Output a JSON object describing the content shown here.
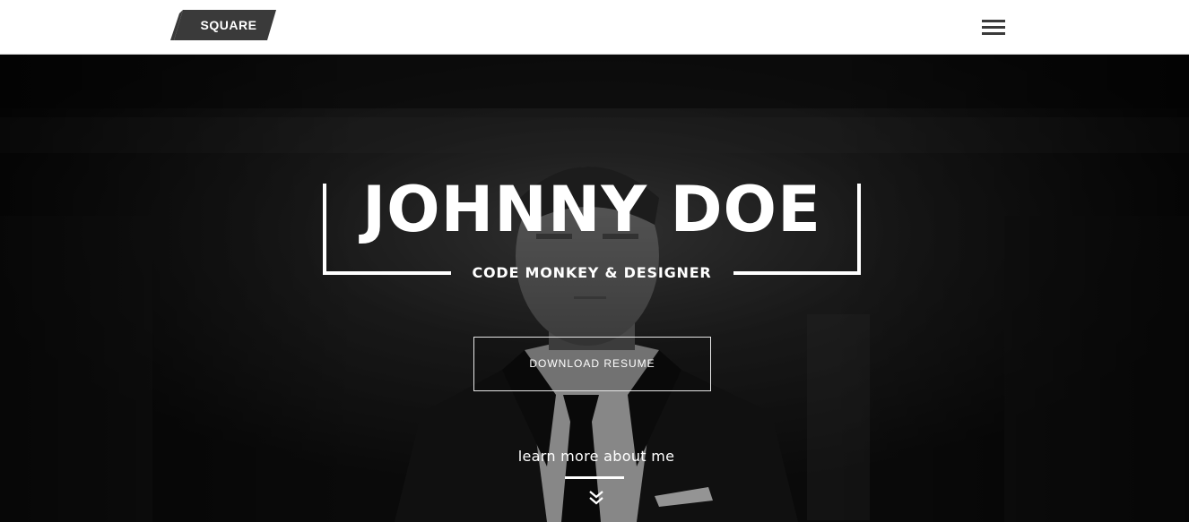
{
  "header": {
    "logo_text": "SQUARE",
    "menu_icon": "hamburger-menu-icon"
  },
  "hero": {
    "name": "JOHNNY DOE",
    "subtitle": "CODE MONKEY & DESIGNER",
    "download_button_label": "DOWNLOAD RESUME",
    "learn_more_label": "learn more about me",
    "scroll_icon": "double-chevron-down-icon"
  },
  "colors": {
    "header_bg": "#ffffff",
    "logo_bg": "#3a3a3a",
    "hero_bg": "#161616",
    "text": "#ffffff"
  }
}
